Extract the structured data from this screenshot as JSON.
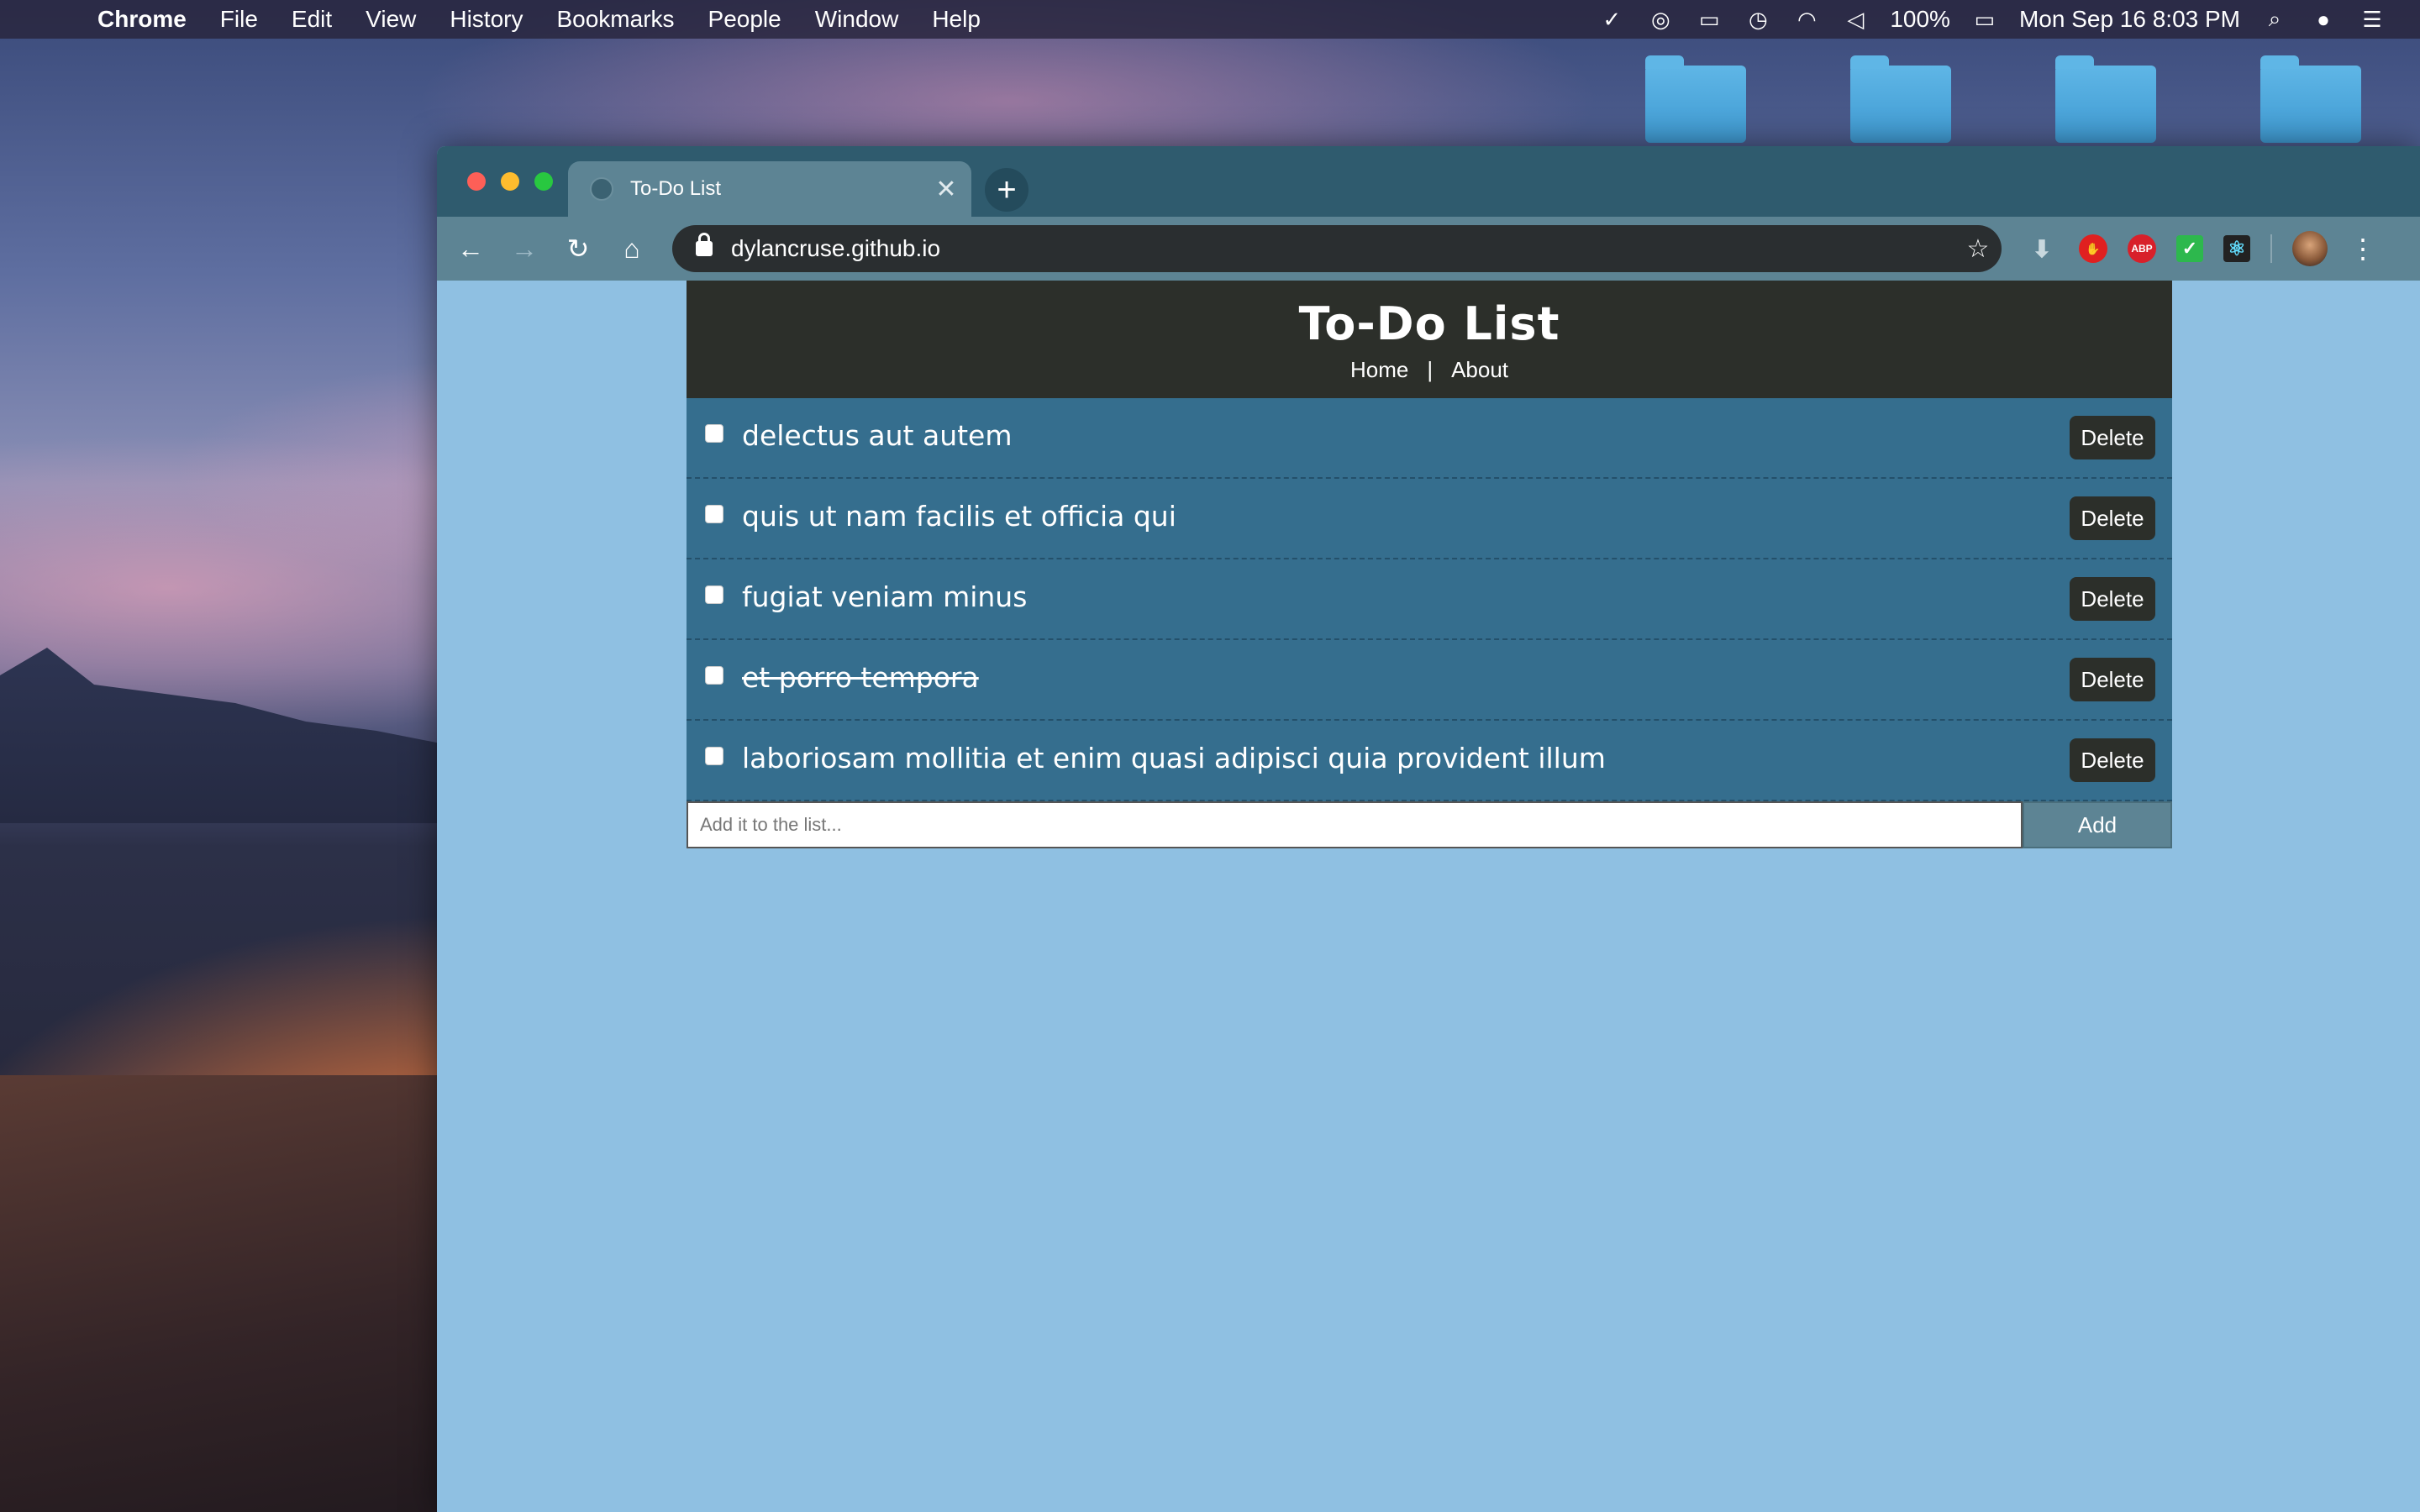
{
  "os_menubar": {
    "app_name": "Chrome",
    "menu_items": [
      "File",
      "Edit",
      "View",
      "History",
      "Bookmarks",
      "People",
      "Window",
      "Help"
    ],
    "battery": "100%",
    "datetime": "Mon Sep 16  8:03 PM"
  },
  "browser": {
    "tab": {
      "title": "To-Do List",
      "close_glyph": "✕"
    },
    "new_tab_glyph": "+",
    "url": "dylancruse.github.io",
    "nav": {
      "back_glyph": "←",
      "forward_glyph": "→",
      "reload_glyph": "↻",
      "home_glyph": "⌂"
    },
    "extensions": {
      "abp_label": "ABP"
    }
  },
  "app": {
    "title": "To-Do List",
    "nav": {
      "home": "Home",
      "separator": "|",
      "about": "About"
    },
    "todos": [
      {
        "text": "delectus aut autem",
        "completed": false,
        "delete_label": "Delete"
      },
      {
        "text": "quis ut nam facilis et officia qui",
        "completed": false,
        "delete_label": "Delete"
      },
      {
        "text": "fugiat veniam minus",
        "completed": false,
        "delete_label": "Delete"
      },
      {
        "text": "et porro tempora",
        "completed": true,
        "delete_label": "Delete"
      },
      {
        "text": "laboriosam mollitia et enim quasi adipisci quia provident illum",
        "completed": false,
        "delete_label": "Delete"
      }
    ],
    "add_form": {
      "placeholder": "Add it to the list...",
      "value": "",
      "button_label": "Add"
    }
  },
  "colors": {
    "header_bg": "#2c2f2a",
    "item_bg": "#356e8e",
    "page_bg": "#8fc0e2",
    "add_button_bg": "#5d8494"
  }
}
